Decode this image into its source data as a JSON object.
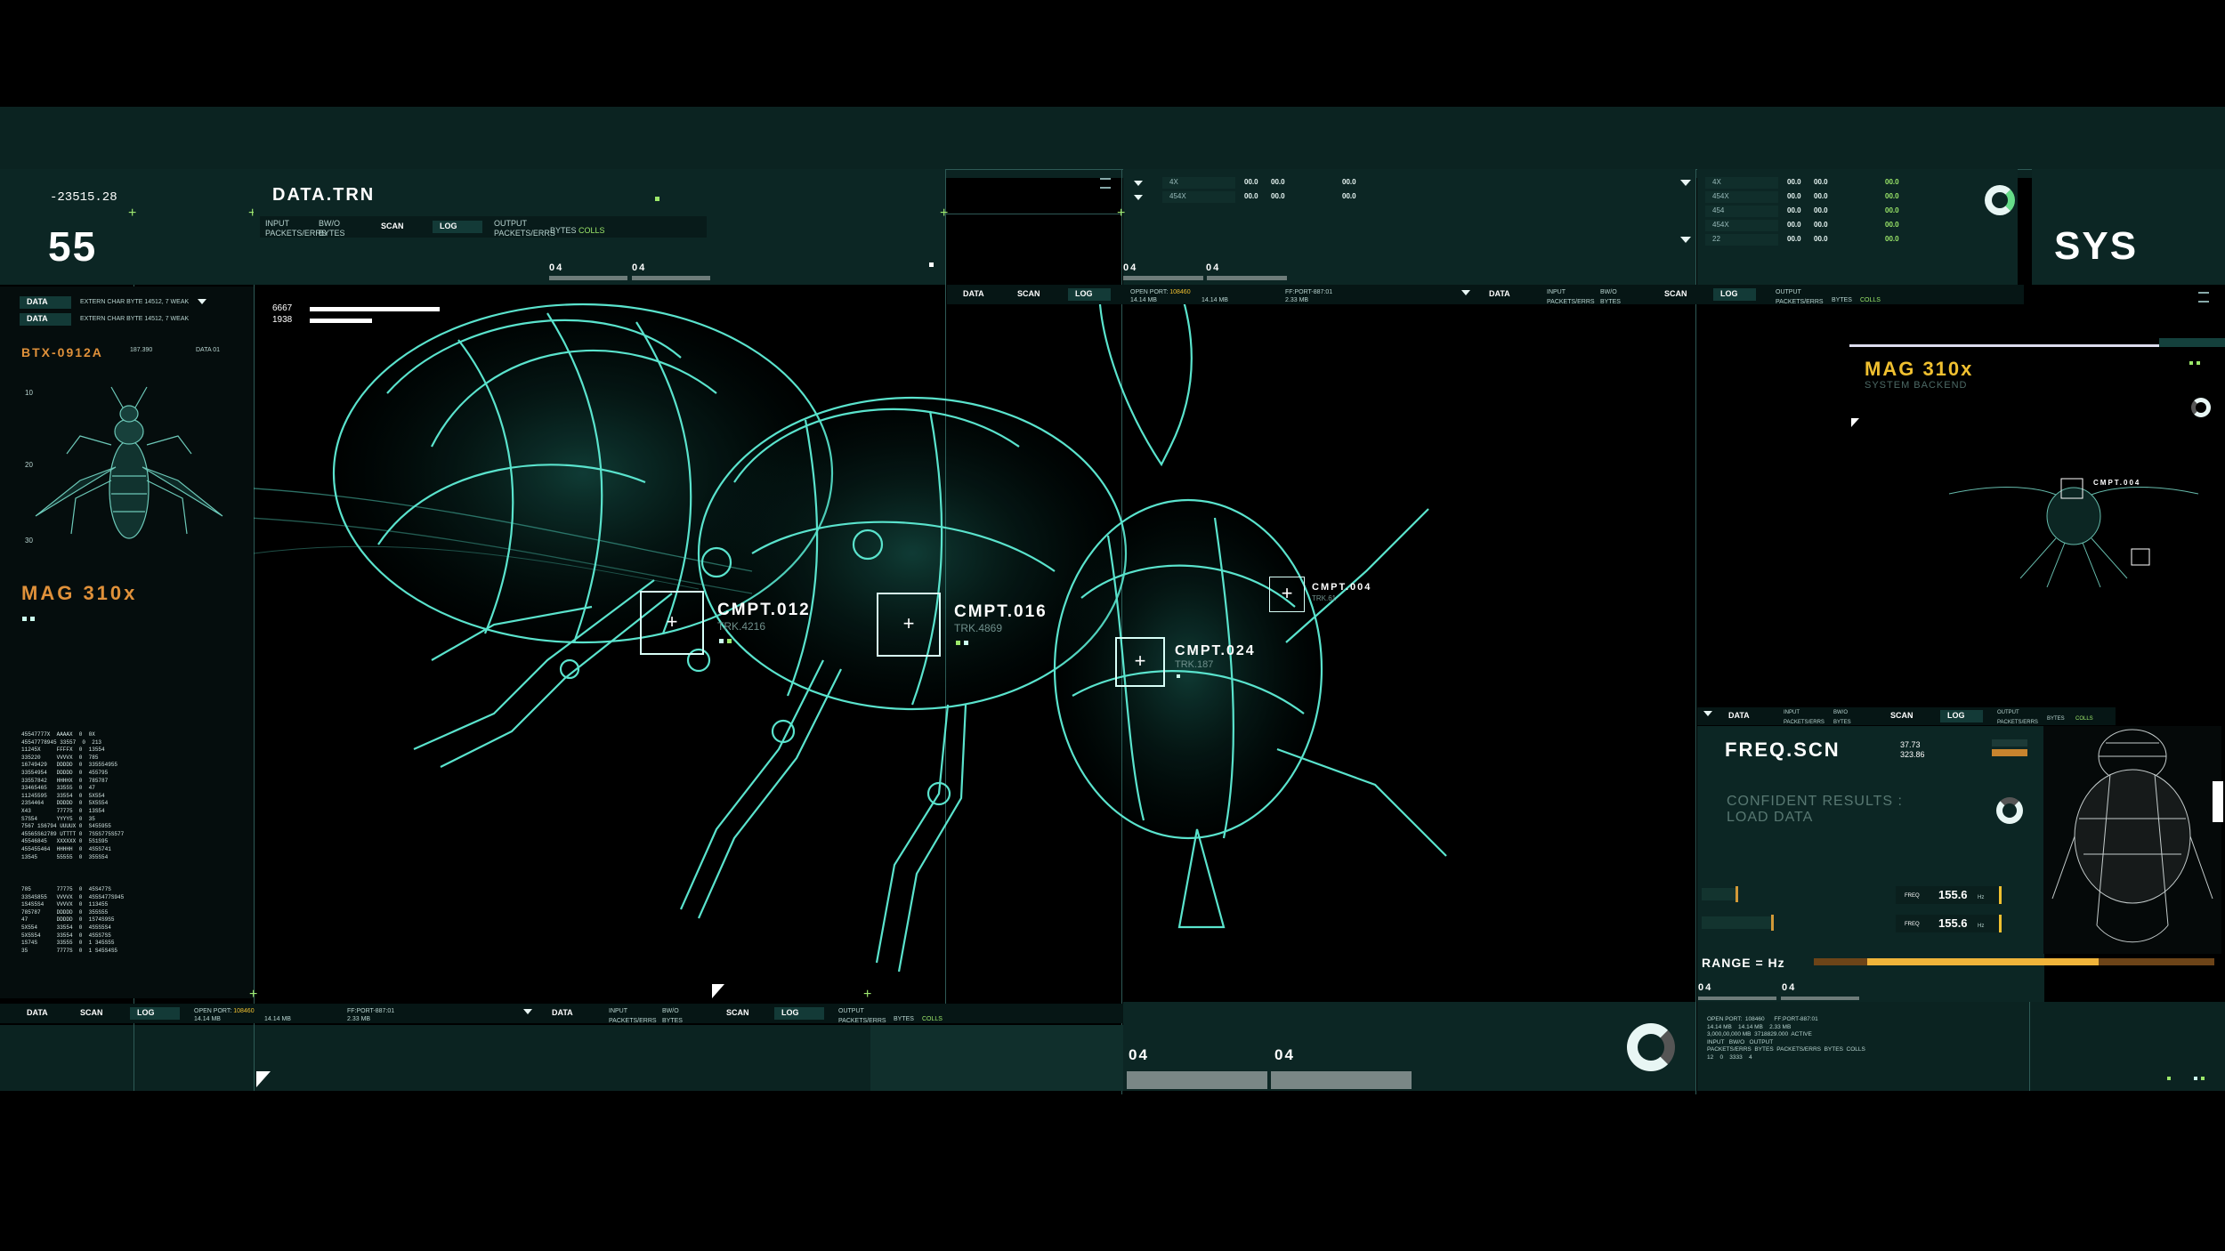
{
  "header_left": {
    "coord": "-23515.28",
    "big_number": "55"
  },
  "data_trn": {
    "title": "DATA.TRN",
    "input_label": "INPUT",
    "input_sub": "PACKETS/ERRS",
    "bw_label": "BW/O",
    "bw_sub": "BYTES",
    "scan_tab": "SCAN",
    "log_tab": "LOG",
    "output_label": "OUTPUT",
    "output_sub": "PACKETS/ERRS",
    "bytes": "BYTES",
    "colls": "COLLS",
    "tick_a": "04",
    "tick_b": "04"
  },
  "top_mid": {
    "rows": [
      {
        "tag": "4X",
        "v1": "00.0",
        "v2": "00.0",
        "v3": "00.0"
      },
      {
        "tag": "454X",
        "v1": "00.0",
        "v2": "00.0",
        "v3": "00.0"
      }
    ],
    "tick_a": "04",
    "tick_b": "04"
  },
  "top_right": {
    "rows": [
      {
        "tag": "4X",
        "v1": "00.0",
        "v2": "00.0",
        "v3": "00.0"
      },
      {
        "tag": "454X",
        "v1": "00.0",
        "v2": "00.0",
        "v3": "00.0"
      },
      {
        "tag": "454",
        "v1": "00.0",
        "v2": "00.0",
        "v3": "00.0"
      },
      {
        "tag": "454X",
        "v1": "00.0",
        "v2": "00.0",
        "v3": "00.0"
      },
      {
        "tag": "22",
        "v1": "00.0",
        "v2": "00.0",
        "v3": "00.0"
      }
    ],
    "sys_label": "SYS"
  },
  "left_panel": {
    "data_tab": "DATA",
    "extern_rows": [
      "EXTERN CHAR BYTE 14512, 7 WEAK",
      "EXTERN CHAR BYTE 14512, 7 WEAK"
    ],
    "specimen_id": "BTX-0912A",
    "meta": [
      "187.390",
      "DATA 01"
    ],
    "scale": [
      "10",
      "20",
      "30"
    ],
    "mag": "MAG 310x",
    "list_a": [
      "45547777X  AAAAX  0  0X",
      "45547778945 33557  0  213",
      "11245X     FFFFX  0  13554",
      "335220     VVVVX  0  785",
      "16749429   DDDDD  0  335554955",
      "33554954   DDDDD  0  455795",
      "33557842   HHHHX  0  785787",
      "33465465   33555  0  47",
      "11245595   33554  0  5X554",
      "23S4464    DDDDD  0  5X5S54",
      "X43        77775  0  13S54",
      "S7S54      YYYY5  0  35",
      "7567 1S6794 UUUUX 0  S455955",
      "45565S62789 UTTTT 0  7S5S775S577",
      "45546845   XXXXXX 0  5S1S95",
      "455455464  HHHHH  0  4S5S741",
      "13545      55555  0  355S54"
    ],
    "list_b": [
      "785        77775  0  45S477S",
      "33S4S855   VVVVX  0  4S5S477S945",
      "1S4S5S4    VVVVX  0  113455",
      "785787     DDDDD  0  355S55",
      "47         DDDDD  0  1S74S9S5",
      "5X554      33554  0  4S5S5S4",
      "5X5S54     33554  0  4S5S7S5",
      "1S74S      33555  0  1 345S55",
      "35         7777S  0  1 S45S4S5"
    ]
  },
  "main_view": {
    "bars": [
      {
        "label": "6667",
        "fraction": 0.95
      },
      {
        "label": "1938",
        "fraction": 0.45
      }
    ],
    "tabs_strip": {
      "data": "DATA",
      "scan": "SCAN",
      "log": "LOG",
      "open_port": "OPEN PORT:",
      "open_port_val": "108460",
      "mb_a": "14.14 MB",
      "mb_b": "14.14 MB",
      "ff_port": "FF:PORT-887:01",
      "ff_mb": "2.33 MB",
      "input_label": "INPUT",
      "input_sub": "PACKETS/ERRS",
      "bw_label": "BW/O",
      "bw_sub": "BYTES",
      "output_label": "OUTPUT",
      "output_sub": "PACKETS/ERRS",
      "bytes": "BYTES",
      "colls": "COLLS"
    },
    "targets": [
      {
        "id": "CMPT.012",
        "trk": "TRK.4216"
      },
      {
        "id": "CMPT.016",
        "trk": "TRK.4869"
      },
      {
        "id": "CMPT.024",
        "trk": "TRK.187"
      },
      {
        "id": "CMPT.004",
        "trk": "TRK.61"
      }
    ]
  },
  "right_panel": {
    "mag": "MAG 310x",
    "sub": "SYSTEM BACKEND",
    "mini_target": "CMPT.004",
    "tabs": {
      "data": "DATA",
      "scan": "SCAN",
      "log": "LOG",
      "input_label": "INPUT",
      "input_sub": "PACKETS/ERRS",
      "bw_label": "BW/O",
      "bw_sub": "BYTES",
      "output_label": "OUTPUT",
      "output_sub": "PACKETS/ERRS",
      "bytes": "BYTES",
      "colls": "COLLS"
    },
    "freq": {
      "title": "FREQ.SCN",
      "v1": "37.73",
      "v2": "323.86",
      "confident": "CONFIDENT RESULTS :",
      "load": "LOAD DATA",
      "freq_label": "FREQ",
      "f1": "155.6",
      "f2": "155.6",
      "unit": "Hz",
      "range": "RANGE = Hz",
      "tick_a": "04",
      "tick_b": "04"
    }
  },
  "bottom": {
    "left_tabs": {
      "data": "DATA",
      "scan": "SCAN",
      "log": "LOG",
      "open_port": "OPEN PORT:",
      "open_port_val": "108460",
      "mb_a": "14.14 MB",
      "mb_b": "14.14 MB",
      "ff_port": "FF:PORT-887:01",
      "ff_mb": "2.33 MB"
    },
    "mid_tabs": {
      "data": "DATA",
      "scan": "SCAN",
      "log": "LOG",
      "input_label": "INPUT",
      "input_sub": "PACKETS/ERRS",
      "bw_label": "BW/O",
      "bw_sub": "BYTES",
      "output_label": "OUTPUT",
      "output_sub": "PACKETS/ERRS",
      "bytes": "BYTES",
      "colls": "COLLS"
    },
    "center_tick_a": "04",
    "center_tick_b": "04",
    "right_info": [
      "OPEN PORT:  108460      FF:PORT-887:01",
      "14.14 MB    14.14 MB    2.33 MB",
      "3,000,00,000 MB  3718829.000  ACTIVE",
      "INPUT   BW/O   OUTPUT",
      "PACKETS/ERRS  BYTES  PACKETS/ERRS  BYTES  COLLS",
      "12    0    3333    4"
    ]
  },
  "colors": {
    "wire": "#5ff0d8",
    "accent_orange": "#e0913a",
    "accent_yellow": "#f0c030",
    "panel": "#0c2624",
    "grid": "#2e5a56"
  }
}
